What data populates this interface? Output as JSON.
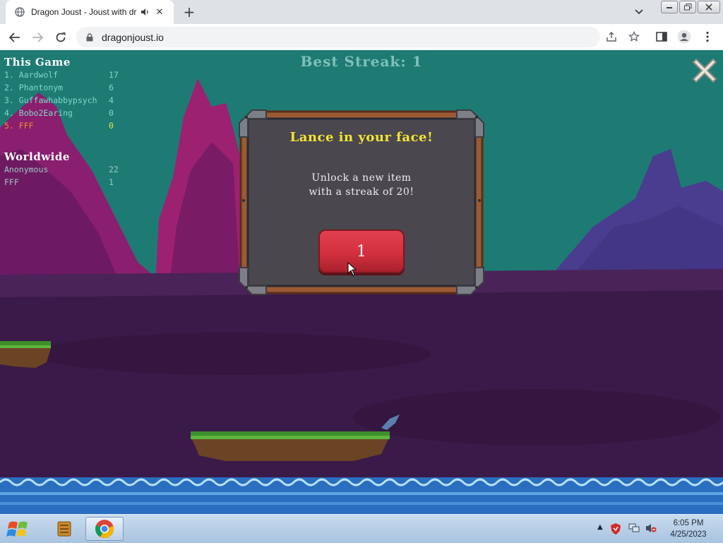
{
  "browser": {
    "tab_title": "Dragon Joust - Joust with dr",
    "new_tab_label": "+",
    "url": "dragonjoust.io"
  },
  "game": {
    "best_streak": "Best Streak: 1",
    "this_game": {
      "heading": "This Game",
      "rows": [
        {
          "name": "1. Aardwolf",
          "score": "17"
        },
        {
          "name": "2. Phantonym",
          "score": "6"
        },
        {
          "name": "3. Guffawhabbypsych",
          "score": "4"
        },
        {
          "name": "4. Bobo2Earing",
          "score": "0"
        },
        {
          "name": "5. FFF",
          "score": "0"
        }
      ]
    },
    "worldwide": {
      "heading": "Worldwide",
      "rows": [
        {
          "name": "Anonymous",
          "score": "22"
        },
        {
          "name": "FFF",
          "score": "1"
        }
      ]
    },
    "modal": {
      "title": "Lance in your face!",
      "line1": "Unlock a new item",
      "line2": "with a streak of 20!",
      "button_label": "1"
    }
  },
  "taskbar": {
    "time": "6:05 PM",
    "date": "4/25/2023"
  },
  "colors": {
    "sky": "#1e7b74",
    "ground": "#3d1a4a",
    "modal_title": "#f4e630",
    "button_red": "#d3303f",
    "highlight_player": "#f28a2e"
  }
}
